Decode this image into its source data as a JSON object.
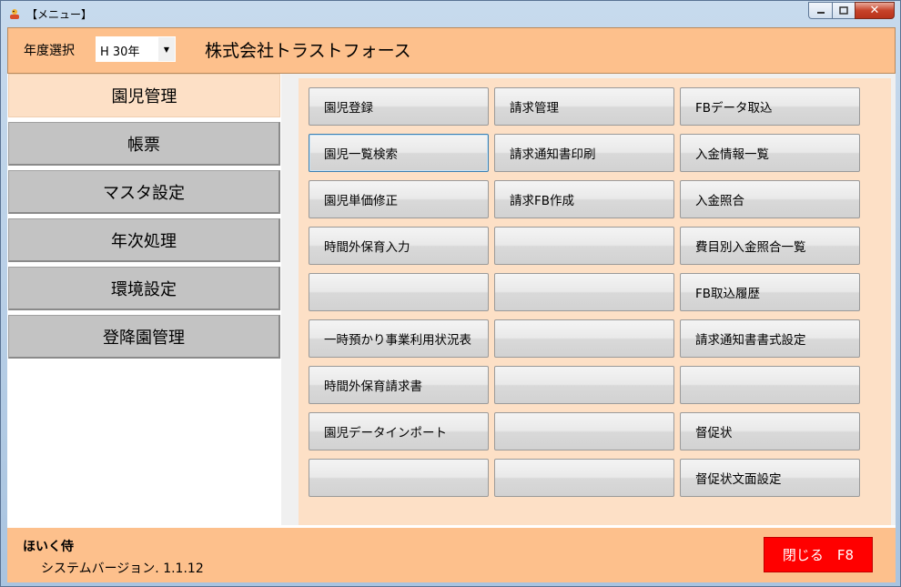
{
  "window": {
    "title": "【メニュー】"
  },
  "header": {
    "year_label": "年度選択",
    "year_value": "H 30年",
    "company": "株式会社トラストフォース"
  },
  "sidebar": {
    "items": [
      {
        "label": "園児管理",
        "active": true
      },
      {
        "label": "帳票"
      },
      {
        "label": "マスタ設定"
      },
      {
        "label": "年次処理"
      },
      {
        "label": "環境設定"
      },
      {
        "label": "登降園管理"
      }
    ]
  },
  "buttons": [
    [
      "園児登録",
      "請求管理",
      "FBデータ取込"
    ],
    [
      "園児一覧検索",
      "請求通知書印刷",
      "入金情報一覧"
    ],
    [
      "園児単価修正",
      "請求FB作成",
      "入金照合"
    ],
    [
      "時間外保育入力",
      "",
      "費目別入金照合一覧"
    ],
    [
      "",
      "",
      "FB取込履歴"
    ],
    [
      "一時預かり事業利用状況表",
      "",
      "請求通知書書式設定"
    ],
    [
      "時間外保育請求書",
      "",
      ""
    ],
    [
      "園児データインポート",
      "",
      "督促状"
    ],
    [
      "",
      "",
      "督促状文面設定"
    ]
  ],
  "footer": {
    "app_name": "ほいく侍",
    "version": "システムバージョン. 1.1.12",
    "close_label": "閉じる　F8"
  },
  "colors": {
    "accent_orange": "#fdc08c",
    "panel_peach": "#fde0c6",
    "close_red": "#ff0000"
  }
}
